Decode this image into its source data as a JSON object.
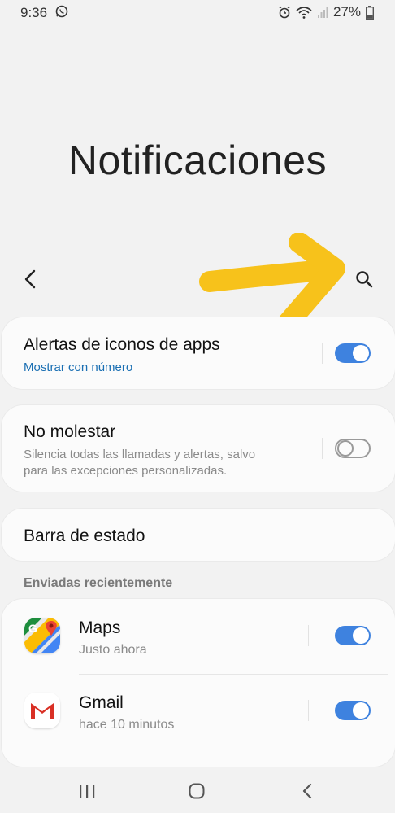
{
  "status_bar": {
    "time": "9:36",
    "battery_percent": "27%"
  },
  "page": {
    "title": "Notificaciones"
  },
  "settings": {
    "app_icon_badges": {
      "title": "Alertas de iconos de apps",
      "subtitle": "Mostrar con número",
      "enabled": true
    },
    "do_not_disturb": {
      "title": "No molestar",
      "subtitle_line1": "Silencia todas las llamadas y alertas, salvo",
      "subtitle_line2": "para las excepciones personalizadas.",
      "enabled": false
    },
    "status_bar": {
      "title": "Barra de estado"
    }
  },
  "recent": {
    "section_label": "Enviadas recientemente",
    "apps": [
      {
        "name": "Maps",
        "time": "Justo ahora",
        "enabled": true,
        "icon": "google-maps-icon"
      },
      {
        "name": "Gmail",
        "time": "hace 10 minutos",
        "enabled": true,
        "icon": "gmail-icon"
      }
    ]
  },
  "colors": {
    "accent": "#3e82df",
    "link": "#1a6fb3",
    "annotation_arrow": "#f7c21b"
  }
}
